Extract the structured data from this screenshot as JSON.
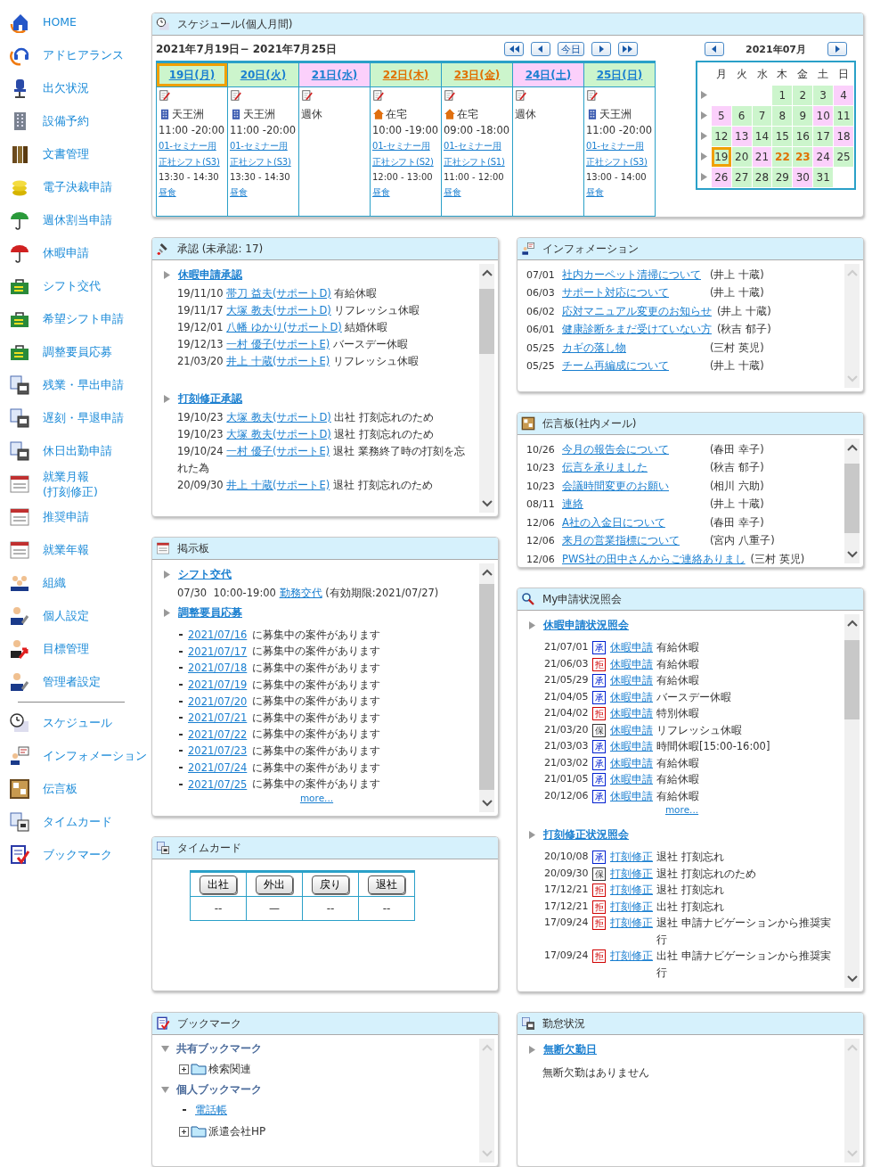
{
  "sidebar": {
    "items": [
      {
        "label": "HOME"
      },
      {
        "label": "アドヒアランス"
      },
      {
        "label": "出欠状況"
      },
      {
        "label": "設備予約"
      },
      {
        "label": "文書管理"
      },
      {
        "label": "電子決裁申請"
      },
      {
        "label": "週休割当申請"
      },
      {
        "label": "休暇申請"
      },
      {
        "label": "シフト交代"
      },
      {
        "label": "希望シフト申請"
      },
      {
        "label": "調整要員応募"
      },
      {
        "label": "残業・早出申請"
      },
      {
        "label": "遅刻・早退申請"
      },
      {
        "label": "休日出勤申請"
      },
      {
        "label": "就業月報\n(打刻修正)"
      },
      {
        "label": "推奨申請"
      },
      {
        "label": "就業年報"
      },
      {
        "label": "組織"
      },
      {
        "label": "個人設定"
      },
      {
        "label": "目標管理"
      },
      {
        "label": "管理者設定"
      }
    ],
    "shortcuts": [
      {
        "label": "スケジュール"
      },
      {
        "label": "インフォメーション"
      },
      {
        "label": "伝言板"
      },
      {
        "label": "タイムカード"
      },
      {
        "label": "ブックマーク"
      }
    ]
  },
  "schedule": {
    "title": "スケジュール(個人月間)",
    "range": "2021年7月19日− 2021年7月25日",
    "today_button": "今日",
    "days": [
      {
        "label": "19日(月)",
        "kind": "work",
        "selected": true,
        "location": {
          "kind": "office",
          "text": "天王洲"
        },
        "hours": "11:00 -20:00",
        "links": [
          "01-セミナー用",
          "正社シフト(S3)"
        ],
        "break_time": "13:30 - 14:30",
        "break_link": "昼食"
      },
      {
        "label": "20日(火)",
        "kind": "work",
        "selected": false,
        "location": {
          "kind": "office",
          "text": "天王洲"
        },
        "hours": "11:00 -20:00",
        "links": [
          "01-セミナー用",
          "正社シフト(S3)"
        ],
        "break_time": "13:30 - 14:30",
        "break_link": "昼食"
      },
      {
        "label": "21日(水)",
        "kind": "off",
        "selected": false,
        "status": "週休"
      },
      {
        "label": "22日(木)",
        "kind": "holiday",
        "selected": false,
        "location": {
          "kind": "home",
          "text": "在宅"
        },
        "hours": "10:00 -19:00",
        "links": [
          "01-セミナー用",
          "正社シフト(S2)"
        ],
        "break_time": "12:00 - 13:00",
        "break_link": "昼食"
      },
      {
        "label": "23日(金)",
        "kind": "holiday",
        "selected": false,
        "location": {
          "kind": "home",
          "text": "在宅"
        },
        "hours": "09:00 -18:00",
        "links": [
          "01-セミナー用",
          "正社シフト(S1)"
        ],
        "break_time": "11:00 - 12:00",
        "break_link": "昼食"
      },
      {
        "label": "24日(土)",
        "kind": "off",
        "selected": false,
        "status": "週休"
      },
      {
        "label": "25日(日)",
        "kind": "work",
        "selected": false,
        "location": {
          "kind": "office",
          "text": "天王洲"
        },
        "hours": "11:00 -20:00",
        "links": [
          "01-セミナー用",
          "正社シフト(S3)"
        ],
        "break_time": "13:00 - 14:00",
        "break_link": "昼食"
      }
    ],
    "calendar": {
      "month": "2021年07月",
      "weekdays": [
        "月",
        "火",
        "水",
        "木",
        "金",
        "土",
        "日"
      ],
      "weeks": [
        [
          {
            "kind": "blank"
          },
          {
            "kind": "blank"
          },
          {
            "kind": "blank"
          },
          {
            "day": "1",
            "kind": "work",
            "selected": false
          },
          {
            "day": "2",
            "kind": "work",
            "selected": false
          },
          {
            "day": "3",
            "kind": "work",
            "selected": false
          },
          {
            "day": "4",
            "kind": "off",
            "selected": false
          }
        ],
        [
          {
            "day": "5",
            "kind": "off",
            "selected": false
          },
          {
            "day": "6",
            "kind": "work",
            "selected": false
          },
          {
            "day": "7",
            "kind": "work",
            "selected": false
          },
          {
            "day": "8",
            "kind": "work",
            "selected": false
          },
          {
            "day": "9",
            "kind": "work",
            "selected": false
          },
          {
            "day": "10",
            "kind": "off",
            "selected": false
          },
          {
            "day": "11",
            "kind": "work",
            "selected": false
          }
        ],
        [
          {
            "day": "12",
            "kind": "work",
            "selected": false
          },
          {
            "day": "13",
            "kind": "off",
            "selected": false
          },
          {
            "day": "14",
            "kind": "work",
            "selected": false
          },
          {
            "day": "15",
            "kind": "work",
            "selected": false
          },
          {
            "day": "16",
            "kind": "work",
            "selected": false
          },
          {
            "day": "17",
            "kind": "work",
            "selected": false
          },
          {
            "day": "18",
            "kind": "off",
            "selected": false
          }
        ],
        [
          {
            "day": "19",
            "kind": "work",
            "selected": true
          },
          {
            "day": "20",
            "kind": "work",
            "selected": false
          },
          {
            "day": "21",
            "kind": "off",
            "selected": false
          },
          {
            "day": "22",
            "kind": "holiday",
            "selected": false
          },
          {
            "day": "23",
            "kind": "holiday",
            "selected": false
          },
          {
            "day": "24",
            "kind": "off",
            "selected": false
          },
          {
            "day": "25",
            "kind": "work",
            "selected": false
          }
        ],
        [
          {
            "day": "26",
            "kind": "off",
            "selected": false
          },
          {
            "day": "27",
            "kind": "work",
            "selected": false
          },
          {
            "day": "28",
            "kind": "work",
            "selected": false
          },
          {
            "day": "29",
            "kind": "work",
            "selected": false
          },
          {
            "day": "30",
            "kind": "off",
            "selected": false
          },
          {
            "day": "31",
            "kind": "work",
            "selected": false
          },
          {
            "kind": "blank"
          }
        ]
      ]
    }
  },
  "approvals": {
    "title": "承認 (未承認: 17)",
    "sections": [
      {
        "title": "休暇申請承認",
        "items": [
          {
            "date": "19/11/10",
            "person": "帯刀 益夫(サポートD)",
            "detail": "有給休暇"
          },
          {
            "date": "19/11/17",
            "person": "大塚 教夫(サポートD)",
            "detail": "リフレッシュ休暇"
          },
          {
            "date": "19/12/01",
            "person": "八幡 ゆかり(サポートD)",
            "detail": "結婚休暇"
          },
          {
            "date": "19/12/13",
            "person": "一村 優子(サポートE)",
            "detail": "バースデー休暇"
          },
          {
            "date": "21/03/20",
            "person": "井上 十蔵(サポートE)",
            "detail": "リフレッシュ休暇"
          }
        ]
      },
      {
        "title": "打刻修正承認",
        "items": [
          {
            "date": "19/10/23",
            "person": "大塚 教夫(サポートD)",
            "detail": "出社 打刻忘れのため"
          },
          {
            "date": "19/10/23",
            "person": "大塚 教夫(サポートD)",
            "detail": "退社 打刻忘れのため"
          },
          {
            "date": "19/10/24",
            "person": "一村 優子(サポートE)",
            "detail": "退社 業務終了時の打刻を忘れた為"
          },
          {
            "date": "20/09/30",
            "person": "井上 十蔵(サポートE)",
            "detail": "退社 打刻忘れのため"
          }
        ]
      }
    ]
  },
  "information": {
    "title": "インフォメーション",
    "items": [
      {
        "date": "07/01",
        "title": "社内カーペット清掃について",
        "author": "(井上 十蔵)"
      },
      {
        "date": "06/03",
        "title": "サポート対応について",
        "author": "(井上 十蔵)"
      },
      {
        "date": "06/02",
        "title": "応対マニュアル変更のお知らせ",
        "author": "(井上 十蔵)"
      },
      {
        "date": "06/01",
        "title": "健康診断をまだ受けていない方",
        "author": "(秋吉 郁子)"
      },
      {
        "date": "05/25",
        "title": "カギの落し物",
        "author": "(三村 英児)"
      },
      {
        "date": "05/25",
        "title": "チーム再編成について",
        "author": "(井上 十蔵)"
      }
    ]
  },
  "messages": {
    "title": "伝言板(社内メール)",
    "items": [
      {
        "date": "10/26",
        "title": "今月の報告会について",
        "author": "(春田 幸子)"
      },
      {
        "date": "10/23",
        "title": "伝言を承りました",
        "author": "(秋吉 郁子)"
      },
      {
        "date": "10/23",
        "title": "会議時間変更のお願い",
        "author": "(相川 六助)"
      },
      {
        "date": "08/11",
        "title": "連絡",
        "author": "(井上 十蔵)"
      },
      {
        "date": "12/06",
        "title": "A社の入金日について",
        "author": "(春田 幸子)"
      },
      {
        "date": "12/06",
        "title": "来月の営業指標について",
        "author": "(宮内 八重子)"
      },
      {
        "date": "12/06",
        "title": "PWS社の田中さんからご連絡ありまし",
        "author": "(三村 英児)"
      }
    ]
  },
  "bulletin": {
    "title": "掲示板",
    "shift_section": {
      "title": "シフト交代",
      "date": "07/30",
      "time": "10:00-19:00",
      "link": "勤務交代",
      "note": "(有効期限:2021/07/27)"
    },
    "recruit_section": {
      "title": "調整要員応募",
      "items": [
        {
          "date": "2021/07/16",
          "text": "に募集中の案件があります"
        },
        {
          "date": "2021/07/17",
          "text": "に募集中の案件があります"
        },
        {
          "date": "2021/07/18",
          "text": "に募集中の案件があります"
        },
        {
          "date": "2021/07/19",
          "text": "に募集中の案件があります"
        },
        {
          "date": "2021/07/20",
          "text": "に募集中の案件があります"
        },
        {
          "date": "2021/07/21",
          "text": "に募集中の案件があります"
        },
        {
          "date": "2021/07/22",
          "text": "に募集中の案件があります"
        },
        {
          "date": "2021/07/23",
          "text": "に募集中の案件があります"
        },
        {
          "date": "2021/07/24",
          "text": "に募集中の案件があります"
        },
        {
          "date": "2021/07/25",
          "text": "に募集中の案件があります"
        }
      ]
    },
    "more": "more..."
  },
  "my_requests": {
    "title": "My申請状況照会",
    "sections": [
      {
        "title": "休暇申請状況照会",
        "more": "more...",
        "items": [
          {
            "date": "21/07/01",
            "badge": "承",
            "color": "#0020d0",
            "link": "休暇申請",
            "detail": "有給休暇"
          },
          {
            "date": "21/06/03",
            "badge": "拒",
            "color": "#d00000",
            "link": "休暇申請",
            "detail": "有給休暇"
          },
          {
            "date": "21/05/29",
            "badge": "承",
            "color": "#0020d0",
            "link": "休暇申請",
            "detail": "有給休暇"
          },
          {
            "date": "21/04/05",
            "badge": "承",
            "color": "#0020d0",
            "link": "休暇申請",
            "detail": "バースデー休暇"
          },
          {
            "date": "21/04/02",
            "badge": "拒",
            "color": "#d00000",
            "link": "休暇申請",
            "detail": "特別休暇"
          },
          {
            "date": "21/03/20",
            "badge": "保",
            "color": "#333333",
            "link": "休暇申請",
            "detail": "リフレッシュ休暇"
          },
          {
            "date": "21/03/03",
            "badge": "承",
            "color": "#0020d0",
            "link": "休暇申請",
            "detail": "時間休暇[15:00-16:00]"
          },
          {
            "date": "21/03/02",
            "badge": "承",
            "color": "#0020d0",
            "link": "休暇申請",
            "detail": "有給休暇"
          },
          {
            "date": "21/01/05",
            "badge": "承",
            "color": "#0020d0",
            "link": "休暇申請",
            "detail": "有給休暇"
          },
          {
            "date": "20/12/06",
            "badge": "承",
            "color": "#0020d0",
            "link": "休暇申請",
            "detail": "有給休暇"
          }
        ]
      },
      {
        "title": "打刻修正状況照会",
        "items": [
          {
            "date": "20/10/08",
            "badge": "承",
            "color": "#0020d0",
            "link": "打刻修正",
            "detail": "退社 打刻忘れ"
          },
          {
            "date": "20/09/30",
            "badge": "保",
            "color": "#333333",
            "link": "打刻修正",
            "detail": "退社 打刻忘れのため"
          },
          {
            "date": "17/12/21",
            "badge": "拒",
            "color": "#d00000",
            "link": "打刻修正",
            "detail": "退社 打刻忘れ"
          },
          {
            "date": "17/12/21",
            "badge": "拒",
            "color": "#d00000",
            "link": "打刻修正",
            "detail": "出社 打刻忘れ"
          },
          {
            "date": "17/09/24",
            "badge": "拒",
            "color": "#d00000",
            "link": "打刻修正",
            "detail": "退社 申請ナビゲーションから推奨実行"
          },
          {
            "date": "17/09/24",
            "badge": "拒",
            "color": "#d00000",
            "link": "打刻修正",
            "detail": "出社 申請ナビゲーションから推奨実行"
          }
        ]
      }
    ]
  },
  "timecard": {
    "title": "タイムカード",
    "buttons": [
      "出社",
      "外出",
      "戻り",
      "退社"
    ],
    "values": [
      "--",
      "—",
      "--",
      "--"
    ]
  },
  "bookmarks": {
    "title": "ブックマーク",
    "tree": [
      {
        "kind": "group",
        "label": "共有ブックマーク",
        "expanded": true,
        "children": [
          {
            "kind": "folder",
            "label": "検索関連",
            "expanded": false
          }
        ]
      },
      {
        "kind": "group",
        "label": "個人ブックマーク",
        "expanded": true,
        "children": [
          {
            "kind": "link",
            "label": "電話帳"
          },
          {
            "kind": "folder",
            "label": "派遣会社HP",
            "expanded": false
          }
        ]
      }
    ]
  },
  "attendance": {
    "title": "勤怠状況",
    "section": "無断欠勤日",
    "text": "無断欠勤はありません"
  }
}
